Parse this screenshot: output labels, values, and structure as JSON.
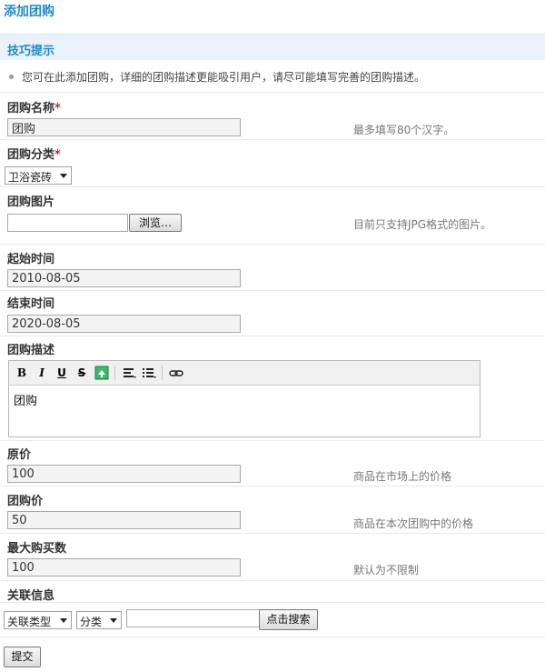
{
  "page": {
    "title": "添加团购"
  },
  "tips": {
    "title": "技巧提示",
    "text": "您可在此添加团购，详细的团购描述更能吸引用户，请尽可能填写完善的团购描述。"
  },
  "form": {
    "name": {
      "label": "团购名称",
      "required_mark": "*",
      "value": "团购",
      "hint": "最多填写80个汉字。"
    },
    "category": {
      "label": "团购分类",
      "required_mark": "*",
      "selected": "卫浴瓷砖"
    },
    "image": {
      "label": "团购图片",
      "file_value": "",
      "browse_label": "浏览…",
      "hint": "目前只支持JPG格式的图片。"
    },
    "start_time": {
      "label": "起始时间",
      "value": "2010-08-05"
    },
    "end_time": {
      "label": "结束时间",
      "value": "2020-08-05"
    },
    "description": {
      "label": "团购描述",
      "toolbar": {
        "bold": "B",
        "italic": "I",
        "underline": "U",
        "strike": "S"
      },
      "content": "团购"
    },
    "original_price": {
      "label": "原价",
      "value": "100",
      "hint": "商品在市场上的价格"
    },
    "group_price": {
      "label": "团购价",
      "value": "50",
      "hint": "商品在本次团购中的价格"
    },
    "max_buy": {
      "label": "最大购买数",
      "value": "100",
      "hint": "默认为不限制"
    },
    "related": {
      "label": "关联信息",
      "type_select": "关联类型",
      "category_select": "分类",
      "search_value": "",
      "search_button": "点击搜索"
    },
    "submit_label": "提交"
  }
}
